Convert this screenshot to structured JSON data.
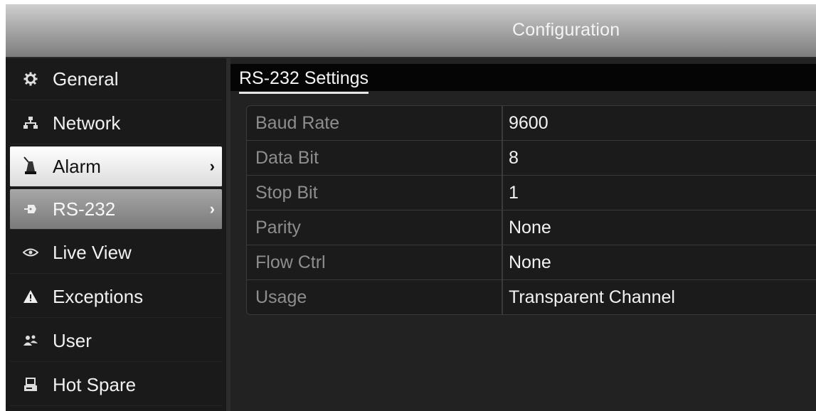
{
  "window": {
    "title": "Configuration"
  },
  "sidebar": {
    "items": [
      {
        "label": "General",
        "icon": "gear-icon",
        "state": "normal"
      },
      {
        "label": "Network",
        "icon": "network-icon",
        "state": "normal"
      },
      {
        "label": "Alarm",
        "icon": "alarm-siren-icon",
        "state": "highlighted",
        "chevron": "›"
      },
      {
        "label": "RS-232",
        "icon": "rs232-plug-icon",
        "state": "selected",
        "chevron": "›"
      },
      {
        "label": "Live View",
        "icon": "eye-icon",
        "state": "normal"
      },
      {
        "label": "Exceptions",
        "icon": "warning-icon",
        "state": "normal"
      },
      {
        "label": "User",
        "icon": "users-icon",
        "state": "normal"
      },
      {
        "label": "Hot Spare",
        "icon": "hot-spare-icon",
        "state": "normal"
      }
    ]
  },
  "main": {
    "section_title": "RS-232 Settings",
    "settings": [
      {
        "label": "Baud Rate",
        "value": "9600"
      },
      {
        "label": "Data Bit",
        "value": "8"
      },
      {
        "label": "Stop Bit",
        "value": "1"
      },
      {
        "label": "Parity",
        "value": "None"
      },
      {
        "label": "Flow Ctrl",
        "value": "None"
      },
      {
        "label": "Usage",
        "value": "Transparent Channel"
      }
    ]
  }
}
